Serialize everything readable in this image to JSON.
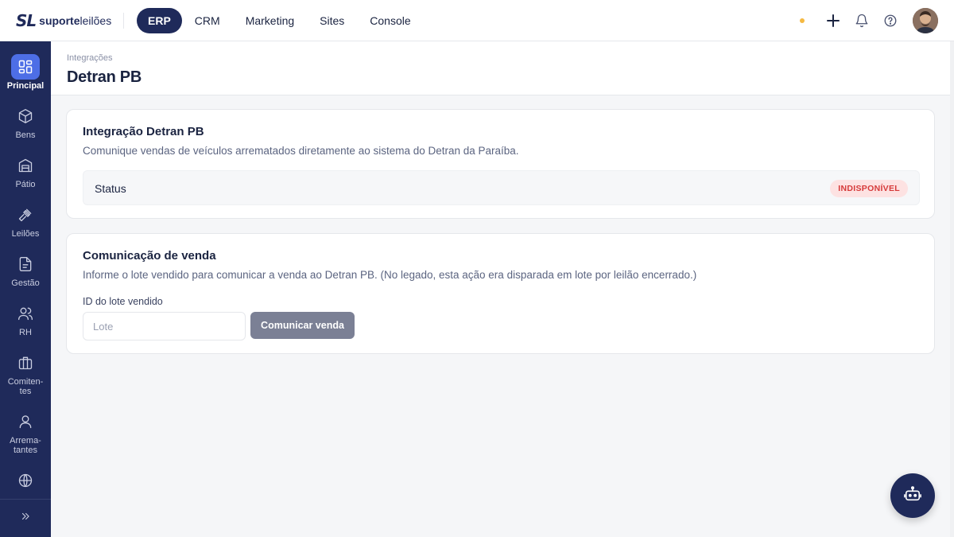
{
  "brand": {
    "mark": "SL",
    "name_bold": "suporte",
    "name_light": "leilões"
  },
  "topnav": [
    {
      "label": "ERP",
      "active": true
    },
    {
      "label": "CRM",
      "active": false
    },
    {
      "label": "Marketing",
      "active": false
    },
    {
      "label": "Sites",
      "active": false
    },
    {
      "label": "Console",
      "active": false
    }
  ],
  "topbar_icons": [
    "status-dot",
    "plus-icon",
    "bell-icon",
    "help-icon",
    "avatar"
  ],
  "sidebar": {
    "items": [
      {
        "label": "Principal",
        "icon": "grid-icon",
        "active": true
      },
      {
        "label": "Bens",
        "icon": "box-icon"
      },
      {
        "label": "Pátio",
        "icon": "warehouse-icon"
      },
      {
        "label": "Leilões",
        "icon": "gavel-icon"
      },
      {
        "label": "Gestão",
        "icon": "document-icon"
      },
      {
        "label": "RH",
        "icon": "users-icon"
      },
      {
        "label": "Comiten-\ntes",
        "icon": "briefcase-icon"
      },
      {
        "label": "Arrema-\ntantes",
        "icon": "user-icon"
      },
      {
        "label": "",
        "icon": "globe-icon"
      }
    ],
    "expand_icon": "chevrons-right-icon"
  },
  "page": {
    "breadcrumb": "Integrações",
    "title": "Detran PB"
  },
  "integration_card": {
    "title": "Integração Detran PB",
    "description": "Comunique vendas de veículos arrematados diretamente ao sistema do Detran da Paraíba.",
    "status_label": "Status",
    "status_value": "INDISPONÍVEL"
  },
  "sale_card": {
    "title": "Comunicação de venda",
    "description": "Informe o lote vendido para comunicar a venda ao Detran PB. (No legado, esta ação era disparada em lote por leilão encerrado.)",
    "field_label": "ID do lote vendido",
    "field_placeholder": "Lote",
    "field_value": "",
    "button_label": "Comunicar venda"
  },
  "colors": {
    "navy": "#1f2a5a",
    "accent": "#4d6ee6",
    "danger": "#d63a3a",
    "warning_dot": "#f5b942"
  }
}
